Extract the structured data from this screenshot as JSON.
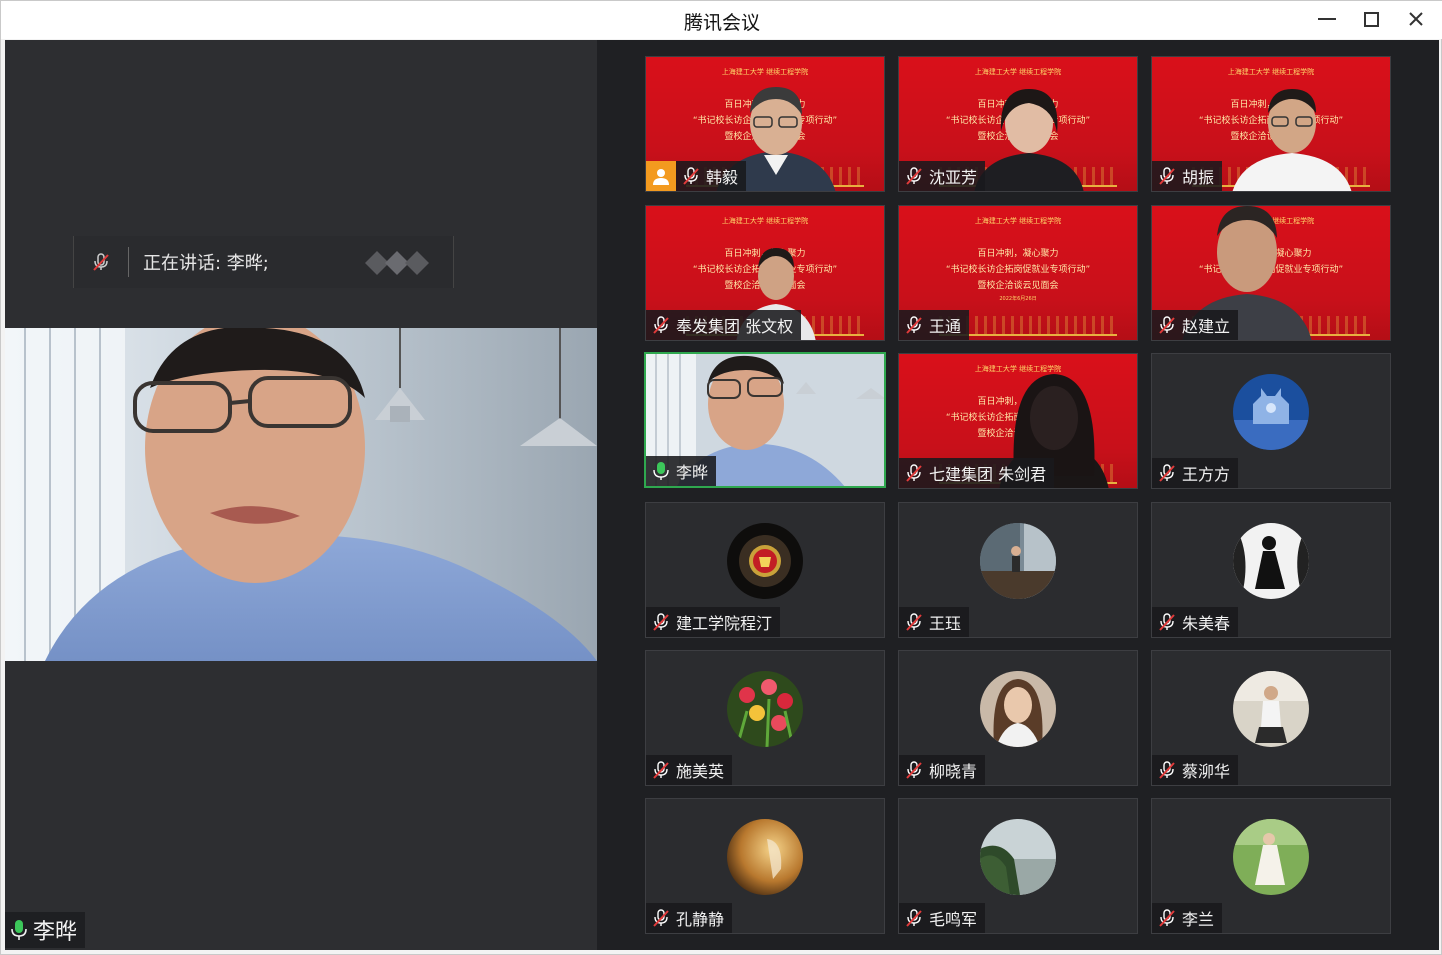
{
  "window": {
    "title": "腾讯会议"
  },
  "controls": {
    "minimize": "minimize",
    "maximize": "maximize",
    "close": "close"
  },
  "main": {
    "speaking_label": "正在讲话: 李晔;",
    "speaker_name": "李晔"
  },
  "banner_text": {
    "logo": "上海建工大学 继续工程学院",
    "line1": "百日冲刺，凝心聚力",
    "line2": "“书记校长访企拓岗促就业专项行动”",
    "line3": "暨校企洽谈云见面会",
    "date": "2022年6月26日"
  },
  "participants": [
    {
      "name": "韩毅",
      "mic": "muted"
    },
    {
      "name": "沈亚芳",
      "mic": "muted"
    },
    {
      "name": "胡振",
      "mic": "muted"
    },
    {
      "name": "奉发集团 张文权",
      "mic": "muted"
    },
    {
      "name": "王通",
      "mic": "muted"
    },
    {
      "name": "赵建立",
      "mic": "muted"
    },
    {
      "name": "李晔",
      "mic": "active"
    },
    {
      "name": "七建集团 朱剑君",
      "mic": "muted"
    },
    {
      "name": "王方方",
      "mic": "muted"
    },
    {
      "name": "建工学院程汀",
      "mic": "muted"
    },
    {
      "name": "王珏",
      "mic": "muted"
    },
    {
      "name": "朱美春",
      "mic": "muted"
    },
    {
      "name": "施美英",
      "mic": "muted"
    },
    {
      "name": "柳晓青",
      "mic": "muted"
    },
    {
      "name": "蔡泖华",
      "mic": "muted"
    },
    {
      "name": "孔静静",
      "mic": "muted"
    },
    {
      "name": "毛鸣军",
      "mic": "muted"
    },
    {
      "name": "李兰",
      "mic": "muted"
    }
  ],
  "colors": {
    "accent_green": "#2fa84f",
    "banner_red": "#d9101a",
    "stage_bg": "#2d2e31"
  }
}
